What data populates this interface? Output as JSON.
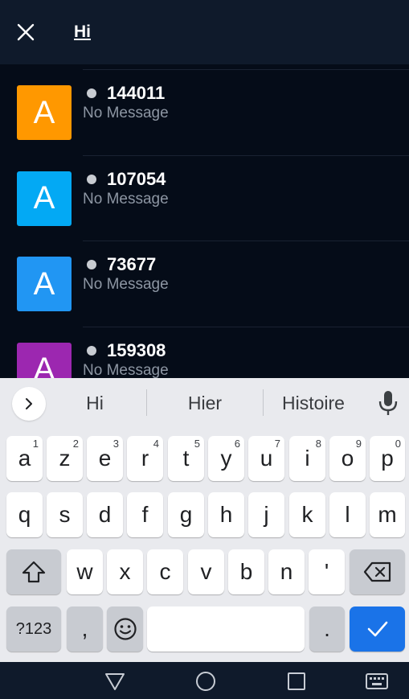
{
  "header": {
    "close_icon": "close-icon",
    "search_query": "Hi"
  },
  "contacts": [
    {
      "initial": "A",
      "name": "144011",
      "message": "No Message",
      "color": "#ff9800"
    },
    {
      "initial": "A",
      "name": "107054",
      "message": "No Message",
      "color": "#03a9f4"
    },
    {
      "initial": "A",
      "name": "73677",
      "message": "No Message",
      "color": "#2196f3"
    },
    {
      "initial": "A",
      "name": "159308",
      "message": "No Message",
      "color": "#9c27b0"
    }
  ],
  "keyboard": {
    "suggestions": [
      "Hi",
      "Hier",
      "Histoire"
    ],
    "row1": [
      {
        "key": "a",
        "hint": "1"
      },
      {
        "key": "z",
        "hint": "2"
      },
      {
        "key": "e",
        "hint": "3"
      },
      {
        "key": "r",
        "hint": "4"
      },
      {
        "key": "t",
        "hint": "5"
      },
      {
        "key": "y",
        "hint": "6"
      },
      {
        "key": "u",
        "hint": "7"
      },
      {
        "key": "i",
        "hint": "8"
      },
      {
        "key": "o",
        "hint": "9"
      },
      {
        "key": "p",
        "hint": "0"
      }
    ],
    "row2": [
      "q",
      "s",
      "d",
      "f",
      "g",
      "h",
      "j",
      "k",
      "l",
      "m"
    ],
    "row3": [
      "w",
      "x",
      "c",
      "v",
      "b",
      "n",
      "'"
    ],
    "symbols_label": "?123",
    "comma_label": ",",
    "period_label": "."
  },
  "colors": {
    "topbar": "#0f1a2b",
    "list_bg": "#050c18",
    "keyboard_bg": "#e9eaee",
    "enter_key": "#1a73e8"
  }
}
